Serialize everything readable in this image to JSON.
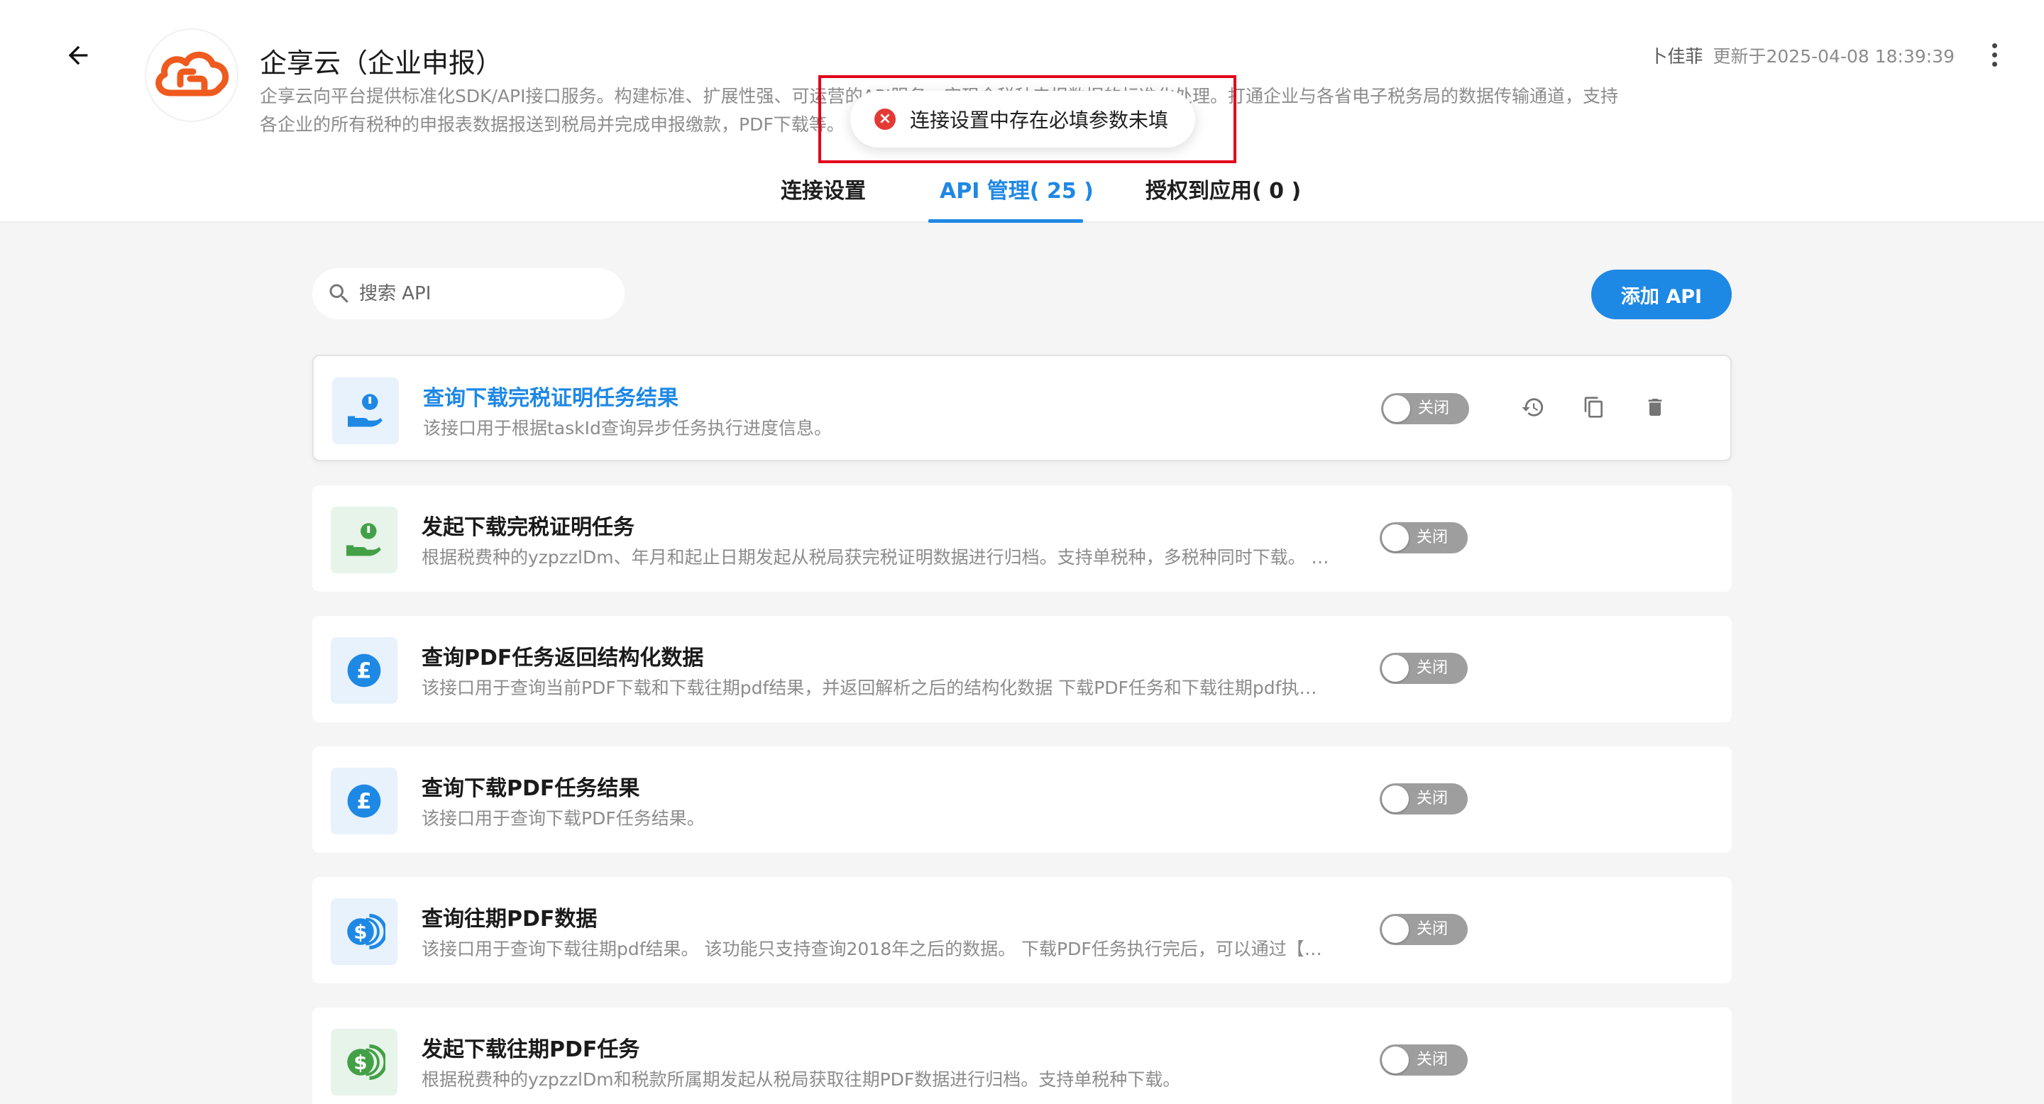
{
  "app": {
    "title": "企享云（企业申报）",
    "description": "企享云向平台提供标准化SDK/API接口服务。构建标准、扩展性强、可运营的API服务，实现全税种申报数据的标准化处理。打通企业与各省电子税务局的数据传输通道，支持各企业的所有税种的申报表数据报送到税局并完成申报缴款，PDF下载等。",
    "user": "卜佳菲",
    "updated": "更新于2025-04-08 18:39:39"
  },
  "tabs": [
    {
      "label": "连接设置"
    },
    {
      "label": "API 管理( 25 )"
    },
    {
      "label": "授权到应用( 0 )"
    }
  ],
  "toast": {
    "message": "连接设置中存在必填参数未填"
  },
  "search": {
    "placeholder": "搜索 API"
  },
  "add_button": "添加 API",
  "apis": [
    {
      "name": "查询下载完税证明任务结果",
      "desc": "该接口用于根据taskId查询异步任务执行进度信息。",
      "switch": "关闭",
      "icon": "hand-coin-icon",
      "color": "#1e88e5"
    },
    {
      "name": "发起下载完税证明任务",
      "desc": "根据税费种的yzpzzlDm、年月和起止日期发起从税局获完税证明数据进行归档。支持单税种，多税种同时下载。 …",
      "switch": "关闭",
      "icon": "hand-coin-icon",
      "color": "#43a047"
    },
    {
      "name": "查询PDF任务返回结构化数据",
      "desc": "该接口用于查询当前PDF下载和下载往期pdf结果，并返回解析之后的结构化数据 下载PDF任务和下载往期pdf执…",
      "switch": "关闭",
      "icon": "pound-icon",
      "color": "#1e88e5"
    },
    {
      "name": "查询下载PDF任务结果",
      "desc": "该接口用于查询下载PDF任务结果。",
      "switch": "关闭",
      "icon": "pound-icon",
      "color": "#1e88e5"
    },
    {
      "name": "查询往期PDF数据",
      "desc": "该接口用于查询下载往期pdf结果。 该功能只支持查询2018年之后的数据。 下载PDF任务执行完后，可以通过【…",
      "switch": "关闭",
      "icon": "dollar-coins-icon",
      "color": "#1e88e5"
    },
    {
      "name": "发起下载往期PDF任务",
      "desc": "根据税费种的yzpzzlDm和税款所属期发起从税局获取往期PDF数据进行归档。支持单税种下载。",
      "switch": "关闭",
      "icon": "dollar-coins-icon",
      "color": "#43a047"
    }
  ]
}
